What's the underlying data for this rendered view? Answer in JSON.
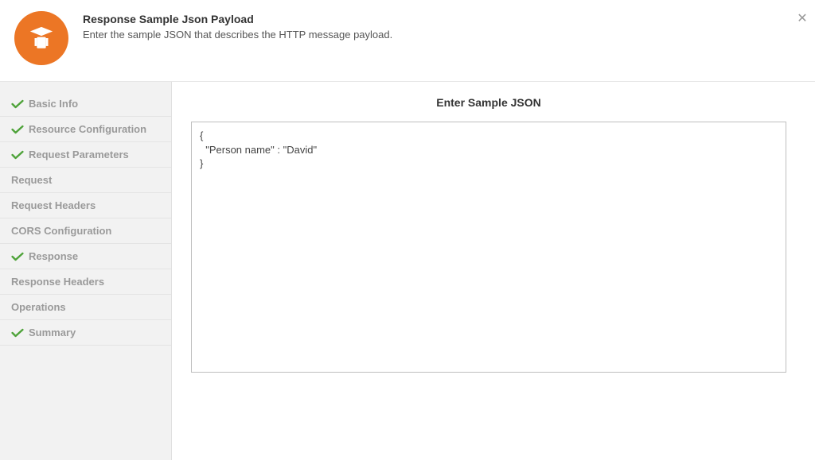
{
  "header": {
    "title": "Response Sample Json Payload",
    "description": "Enter the sample JSON that describes the HTTP message payload.",
    "icon": "wizard-icon"
  },
  "sidebar": {
    "items": [
      {
        "label": "Basic Info",
        "checked": true
      },
      {
        "label": "Resource Configuration",
        "checked": true
      },
      {
        "label": "Request Parameters",
        "checked": true
      },
      {
        "label": "Request",
        "checked": false
      },
      {
        "label": "Request Headers",
        "checked": false
      },
      {
        "label": "CORS Configuration",
        "checked": false
      },
      {
        "label": "Response",
        "checked": true
      },
      {
        "label": "Response Headers",
        "checked": false
      },
      {
        "label": "Operations",
        "checked": false
      },
      {
        "label": "Summary",
        "checked": true
      }
    ]
  },
  "main": {
    "section_title": "Enter Sample JSON",
    "sample_json": "{\n  \"Person name\" : \"David\"\n}"
  }
}
